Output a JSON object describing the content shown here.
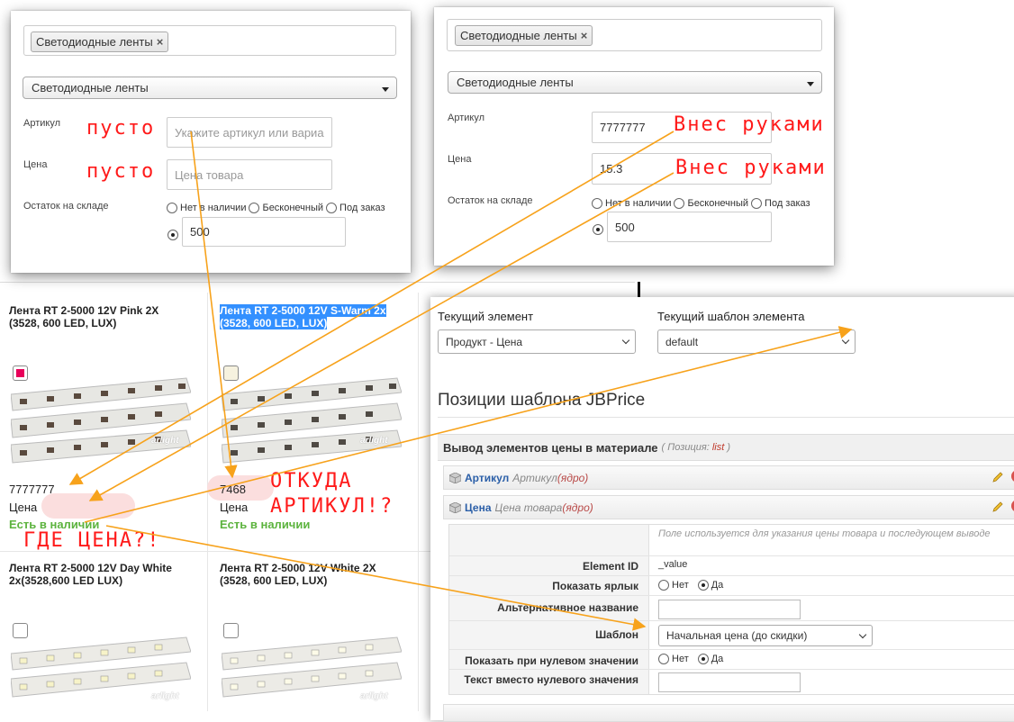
{
  "panel_left": {
    "tag": "Светодиодные ленты",
    "tag_remove": "×",
    "category_select": "Светодиодные ленты",
    "sku_label": "Артикул",
    "sku_placeholder": "Укажите артикул или вариа",
    "price_label": "Цена",
    "price_placeholder": "Цена товара",
    "stock_label": "Остаток на складе",
    "stock_options": [
      "Нет в наличии",
      "Бесконечный",
      "Под заказ"
    ],
    "stock_value": "500",
    "note_sku": "пусто",
    "note_price": "пусто"
  },
  "panel_right": {
    "tag": "Светодиодные ленты",
    "tag_remove": "×",
    "category_select": "Светодиодные ленты",
    "sku_label": "Артикул",
    "sku_value": "7777777",
    "price_label": "Цена",
    "price_value": "15.3",
    "stock_label": "Остаток на складе",
    "stock_options": [
      "Нет в наличии",
      "Бесконечный",
      "Под заказ"
    ],
    "stock_value": "500",
    "note_sku": "Внес руками",
    "note_price": "Внес руками"
  },
  "products": [
    {
      "title_line1": "Лента RT 2-5000 12V Pink 2X",
      "title_line2": "(3528, 600 LED, LUX)",
      "sku": "7777777",
      "price_label": "Цена",
      "stock": "Есть в наличии"
    },
    {
      "title_line1": "Лента RT 2-5000 12V S-Warm 2x",
      "title_line2": "(3528, 600 LED, LUX)",
      "sku": "7468",
      "price_label": "Цена",
      "stock": "Есть в наличии"
    },
    {
      "title_line1": "Лента RT 2-5000 12V Day White",
      "title_line2": "2x(3528,600 LED LUX)"
    },
    {
      "title_line1": "Лента RT 2-5000 12V White 2X",
      "title_line2": "(3528, 600 LED, LUX)"
    }
  ],
  "image_brand": "arlight",
  "notes": {
    "where_price": "ГДЕ ЦЕНА?!",
    "where_sku_1": "ОТКУДА",
    "where_sku_2": "АРТИКУЛ!?"
  },
  "config": {
    "current_element_label": "Текущий элемент",
    "current_element_value": "Продукт - Цена",
    "current_template_label": "Текущий шаблон элемента",
    "current_template_value": "default",
    "heading": "Позиции шаблона JBPrice",
    "section_title": "Вывод элементов цены в материале",
    "section_meta_prefix": "( Позиция:",
    "section_meta_pos": "list",
    "section_meta_suffix": ")",
    "elements": [
      {
        "name": "Артикул",
        "desc": "Артикул",
        "core": "(ядро)"
      },
      {
        "name": "Цена",
        "desc": "Цена товара",
        "core": "(ядро)"
      }
    ],
    "hint": "Поле используется для указания цены товара и последующем выводе",
    "props": {
      "element_id_label": "Element ID",
      "element_id_value": "_value",
      "show_label_label": "Показать ярлык",
      "no": "Нет",
      "yes": "Да",
      "alt_name_label": "Альтернативное название",
      "template_label": "Шаблон",
      "template_value": "Начальная цена (до скидки)",
      "show_zero_label": "Показать при нулевом значении",
      "zero_text_label": "Текст вместо нулевого значения"
    }
  },
  "colors": {
    "annotation_red": "#ff1a1a",
    "arrow_orange": "#f7a21b",
    "stock_green": "#5cb33e",
    "link_blue": "#2b5fa8"
  }
}
